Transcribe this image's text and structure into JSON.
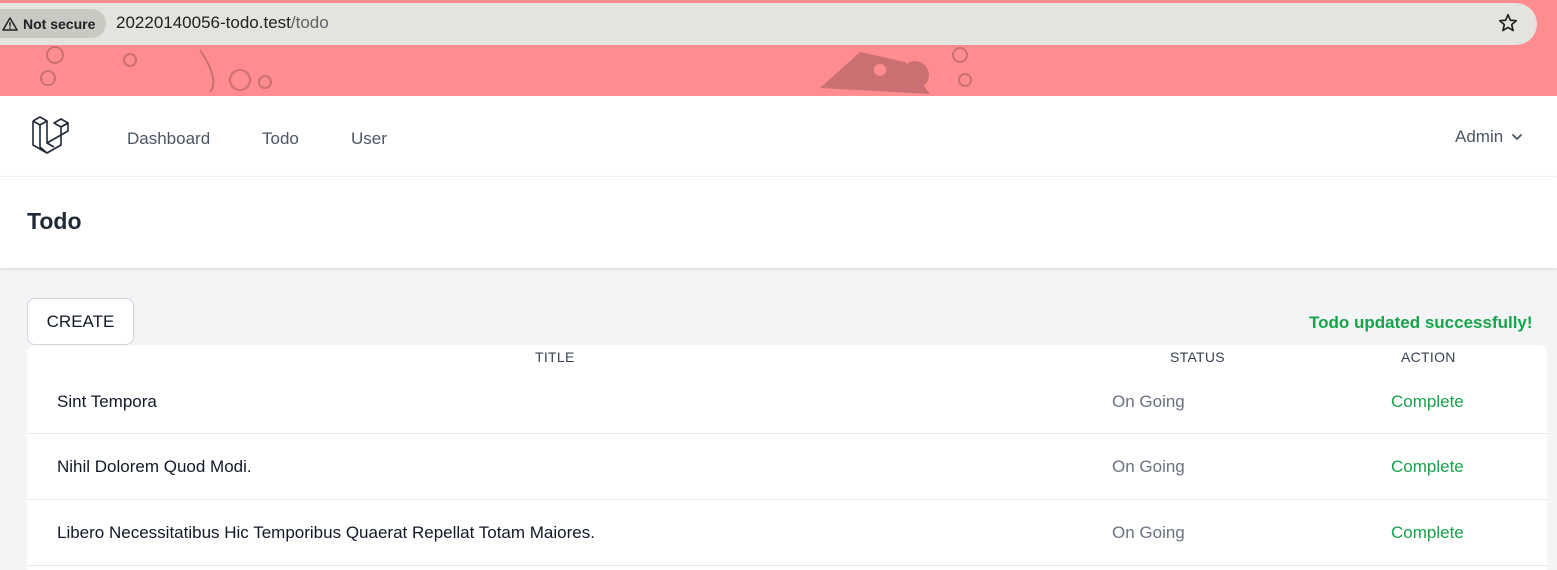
{
  "browser": {
    "security_label": "Not secure",
    "url_host": "20220140056-todo.test",
    "url_path": "/todo"
  },
  "nav": {
    "links": [
      {
        "label": "Dashboard"
      },
      {
        "label": "Todo"
      },
      {
        "label": "User"
      }
    ],
    "user_menu_label": "Admin"
  },
  "header": {
    "title": "Todo"
  },
  "toolbar": {
    "create_label": "CREATE",
    "flash_message": "Todo updated successfully!"
  },
  "table": {
    "headers": [
      "TITLE",
      "STATUS",
      "ACTION"
    ],
    "rows": [
      {
        "title": "Sint Tempora",
        "status": "On Going",
        "action": "Complete"
      },
      {
        "title": "Nihil Dolorem Quod Modi.",
        "status": "On Going",
        "action": "Complete"
      },
      {
        "title": "Libero Necessitatibus Hic Temporibus Quaerat Repellat Totam Maiores.",
        "status": "On Going",
        "action": "Complete"
      }
    ]
  },
  "colors": {
    "chrome_background": "#ff8c8f",
    "success": "#16a34a",
    "status_text": "#6b7280"
  },
  "icons": {
    "security": "warning-triangle-icon",
    "bookmark": "star-icon",
    "logo": "laravel-logo-icon",
    "dropdown": "chevron-down-icon"
  }
}
